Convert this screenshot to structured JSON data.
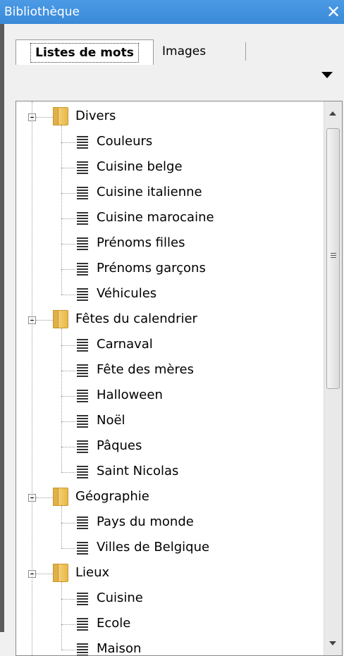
{
  "window": {
    "title": "Bibliothèque",
    "close_glyph": "✕"
  },
  "tabs": [
    {
      "label": "Listes de mots",
      "active": true
    },
    {
      "label": "Images",
      "active": false
    }
  ],
  "tree": [
    {
      "label": "Divers",
      "children": [
        "Couleurs",
        "Cuisine belge",
        "Cuisine italienne",
        "Cuisine marocaine",
        "Prénoms filles",
        "Prénoms garçons",
        "Véhicules"
      ]
    },
    {
      "label": "Fêtes du calendrier",
      "children": [
        "Carnaval",
        "Fête des mères",
        "Halloween",
        "Noël",
        "Pâques",
        "Saint Nicolas"
      ]
    },
    {
      "label": "Géographie",
      "children": [
        "Pays du monde",
        "Villes de Belgique"
      ]
    },
    {
      "label": "Lieux",
      "children": [
        "Cuisine",
        "Ecole",
        "Maison"
      ]
    }
  ],
  "icons": {
    "folder": "folder-icon",
    "list": "list-icon",
    "expander": "collapse-icon"
  }
}
